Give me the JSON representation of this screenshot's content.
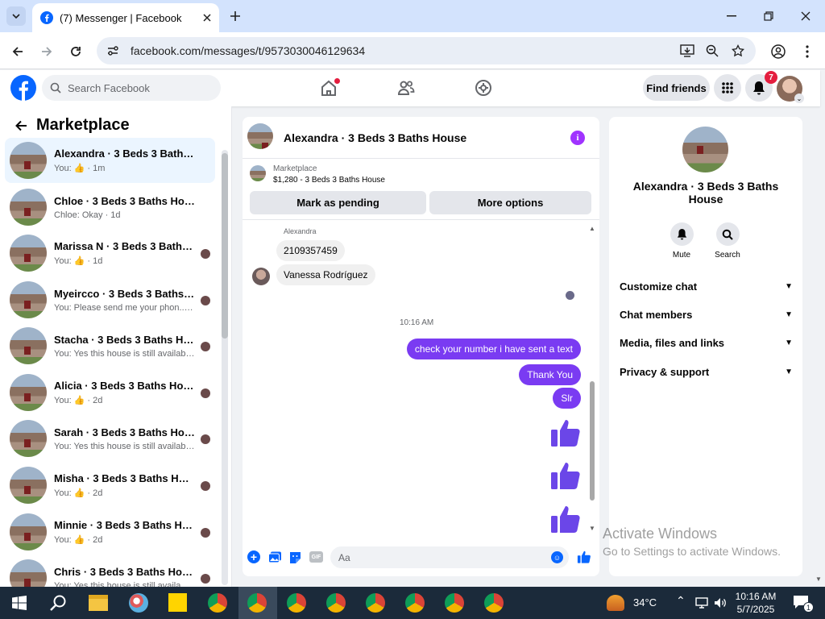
{
  "browser": {
    "tab_title": "(7) Messenger | Facebook",
    "url": "facebook.com/messages/t/9573030046129634"
  },
  "fb": {
    "search_placeholder": "Search Facebook",
    "find_friends": "Find friends",
    "notif_count": "7"
  },
  "left": {
    "title": "Marketplace",
    "conversations": [
      {
        "title": "Alexandra · 3 Beds 3 Baths House",
        "sub": "You: 👍 · 1m",
        "selected": true
      },
      {
        "title": "Chloe · 3 Beds 3 Baths House",
        "sub": "Chloe: Okay · 1d"
      },
      {
        "title": "Marissa N · 3 Beds 3 Baths H...",
        "sub": "You: 👍 · 1d"
      },
      {
        "title": "Myeircco · 3 Beds 3 Baths Ho...",
        "sub": "You: Please send me your phon... · 1d"
      },
      {
        "title": "Stacha · 3 Beds 3 Baths House",
        "sub": "You: Yes this house is still available ... · 1d"
      },
      {
        "title": "Alicia · 3 Beds 3 Baths House",
        "sub": "You: 👍 · 2d"
      },
      {
        "title": "Sarah · 3 Beds 3 Baths House",
        "sub": "You: Yes this house is still available ... · 2d"
      },
      {
        "title": "Misha · 3 Beds 3 Baths House",
        "sub": "You: 👍 · 2d"
      },
      {
        "title": "Minnie · 3 Beds 3 Baths House",
        "sub": "You: 👍 · 2d"
      },
      {
        "title": "Chris · 3 Beds 3 Baths House",
        "sub": "You: Yes this house is still availa... · 2d"
      }
    ]
  },
  "chat": {
    "header_title": "Alexandra · 3 Beds 3 Baths House",
    "listing_label": "Marketplace",
    "listing_price": "$1,280 - 3 Beds 3 Baths House",
    "mark_pending": "Mark as pending",
    "more_options": "More options",
    "sender_name": "Alexandra",
    "msg_in_1": "2109357459",
    "msg_in_2": "Vanessa Rodríguez",
    "timestamp": "10:16 AM",
    "msg_out_1": "check your number i have sent a text",
    "msg_out_2": "Thank You",
    "msg_out_3": "Slr",
    "composer_placeholder": "Aa"
  },
  "right": {
    "title": "Alexandra · 3 Beds 3 Baths House",
    "mute": "Mute",
    "search": "Search",
    "sections": [
      "Customize chat",
      "Chat members",
      "Media, files and links",
      "Privacy & support"
    ]
  },
  "watermark": {
    "line1": "Activate Windows",
    "line2": "Go to Settings to activate Windows."
  },
  "taskbar": {
    "weather": "34°C",
    "time": "10:16 AM",
    "date": "5/7/2025",
    "notif": "1"
  },
  "colors": {
    "fb_blue": "#0866ff",
    "messenger_purple": "#7a3bf2"
  }
}
